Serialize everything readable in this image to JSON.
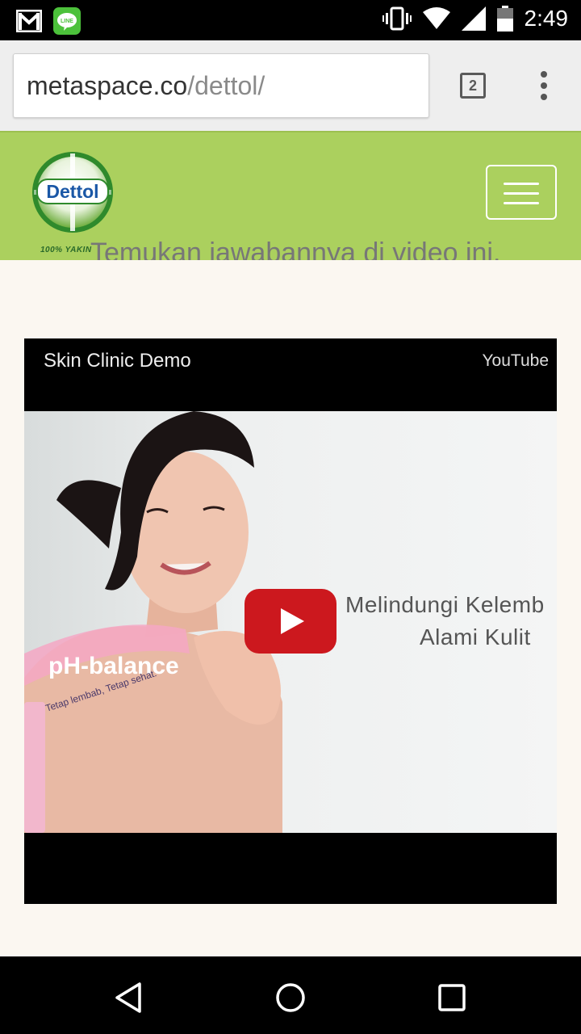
{
  "status_bar": {
    "time": "2:49",
    "icons": [
      "gmail-icon",
      "line-icon",
      "vibrate-icon",
      "wifi-icon",
      "signal-icon",
      "battery-icon"
    ]
  },
  "browser": {
    "url_domain": "metaspace.co",
    "url_path": "/dettol/",
    "tab_count": "2"
  },
  "site": {
    "logo_text": "Dettol",
    "logo_tagline": "100% YAKIN",
    "header_color": "#abd05e"
  },
  "content": {
    "partial_text": "Temukan jawabannya di video ini."
  },
  "video": {
    "title": "Skin Clinic Demo",
    "source": "YouTube",
    "overlay_line1": "Melindungi Kelemb",
    "overlay_line2": "Alami Kulit",
    "product_label": "pH-balance",
    "product_slogan": "Tetap lembab, Tetap sehat."
  },
  "colors": {
    "play_red": "#cc181e",
    "dettol_green": "#2f8a2c"
  }
}
